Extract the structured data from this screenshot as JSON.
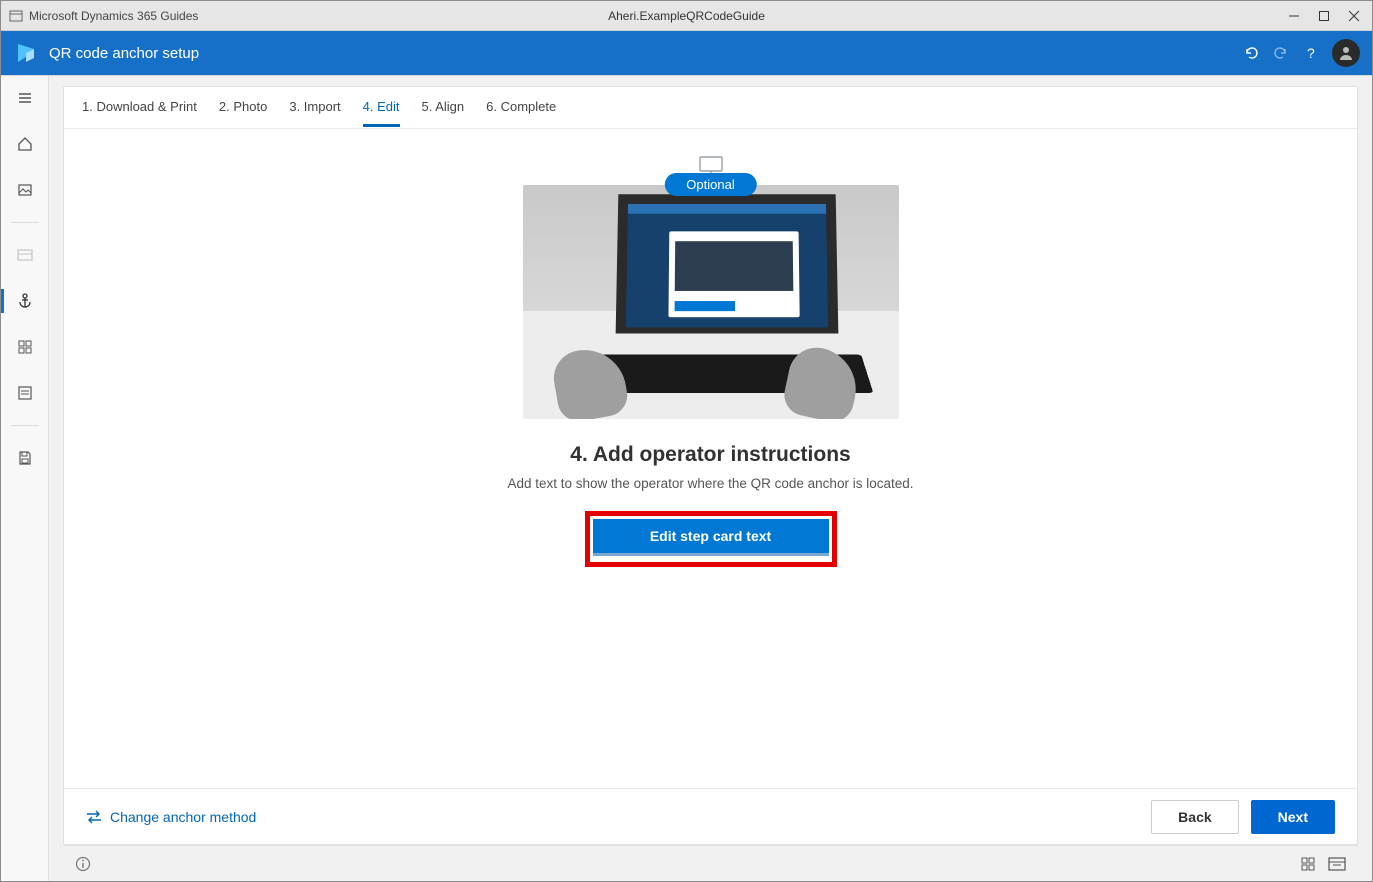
{
  "titlebar": {
    "app_name": "Microsoft Dynamics 365 Guides",
    "document_name": "Aheri.ExampleQRCodeGuide"
  },
  "header": {
    "title": "QR code anchor setup"
  },
  "leftrail": {
    "items": [
      {
        "name": "hamburger-icon"
      },
      {
        "name": "home-icon"
      },
      {
        "name": "image-icon"
      },
      {
        "name": "divider"
      },
      {
        "name": "card-icon"
      },
      {
        "name": "anchor-icon",
        "active": true
      },
      {
        "name": "grid-icon"
      },
      {
        "name": "form-icon"
      },
      {
        "name": "divider"
      },
      {
        "name": "save-icon"
      }
    ]
  },
  "tabs": [
    {
      "label": "1. Download & Print"
    },
    {
      "label": "2. Photo"
    },
    {
      "label": "3. Import"
    },
    {
      "label": "4. Edit",
      "active": true
    },
    {
      "label": "5. Align"
    },
    {
      "label": "6. Complete"
    }
  ],
  "content": {
    "optional_badge": "Optional",
    "step_title": "4. Add operator instructions",
    "step_desc": "Add text to show the operator where the QR code anchor is located.",
    "edit_button": "Edit step card text"
  },
  "footer": {
    "change_link": "Change anchor method",
    "back": "Back",
    "next": "Next"
  }
}
